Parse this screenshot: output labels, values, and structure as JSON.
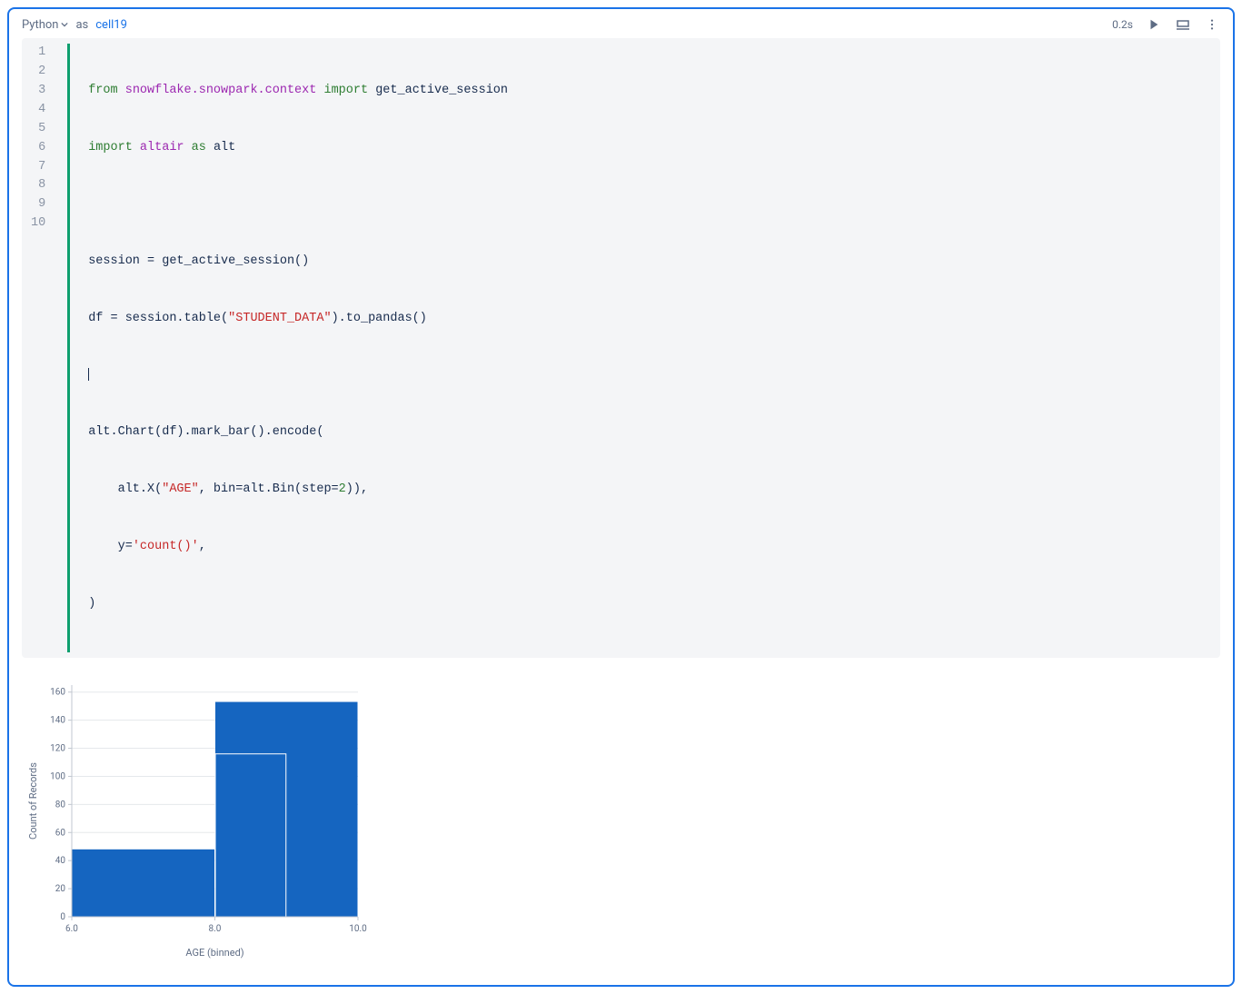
{
  "cell": {
    "language": "Python",
    "as_label": "as",
    "name": "cell19",
    "exec_time": "0.2s"
  },
  "code": {
    "lines": [
      "1",
      "2",
      "3",
      "4",
      "5",
      "6",
      "7",
      "8",
      "9",
      "10"
    ],
    "src": {
      "l1_from": "from",
      "l1_mod": "snowflake.snowpark.context",
      "l1_import": "import",
      "l1_target": "get_active_session",
      "l2_import": "import",
      "l2_mod": "altair",
      "l2_as": "as",
      "l2_alias": "alt",
      "l4": "session = get_active_session()",
      "l5_a": "df = session.table(",
      "l5_str": "\"STUDENT_DATA\"",
      "l5_b": ").to_pandas()",
      "l7": "alt.Chart(df).mark_bar().encode(",
      "l8_a": "    alt.X(",
      "l8_str": "\"AGE\"",
      "l8_b": ", bin=alt.Bin(step=",
      "l8_num": "2",
      "l8_c": ")),",
      "l9_a": "    y=",
      "l9_str": "'count()'",
      "l9_b": ",",
      "l10": ")"
    }
  },
  "chart_data": {
    "type": "bar",
    "xlabel": "AGE (binned)",
    "ylabel": "Count of Records",
    "x_ticks": [
      "6.0",
      "8.0",
      "10.0"
    ],
    "y_ticks": [
      "0",
      "20",
      "40",
      "60",
      "80",
      "100",
      "120",
      "140",
      "160"
    ],
    "ylim": [
      0,
      165
    ],
    "bins": [
      {
        "start": 6.0,
        "end": 8.0,
        "count": 48
      },
      {
        "start": 8.0,
        "end": 10.0,
        "count": 153
      }
    ],
    "hover": {
      "bin_start": 8.0,
      "bin_end": 9.0,
      "approx_value": 116
    }
  }
}
